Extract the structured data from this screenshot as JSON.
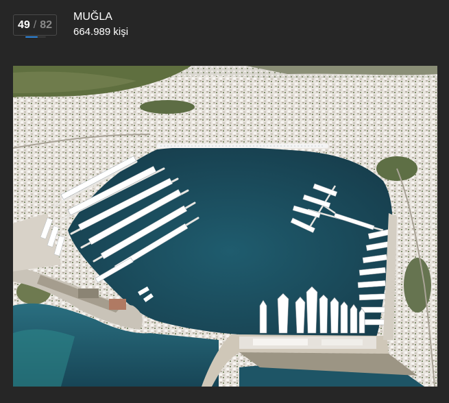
{
  "counter": {
    "current": "49",
    "separator": "/",
    "total": "82",
    "progress_fraction": 0.598
  },
  "city": {
    "name": "MUĞLA",
    "population": "664.989 kişi"
  },
  "image": {
    "alt_subject": "harbor-aerial-photo"
  },
  "colors": {
    "background": "#262626",
    "accent": "#2f88e0",
    "sea": "#1d5363"
  }
}
